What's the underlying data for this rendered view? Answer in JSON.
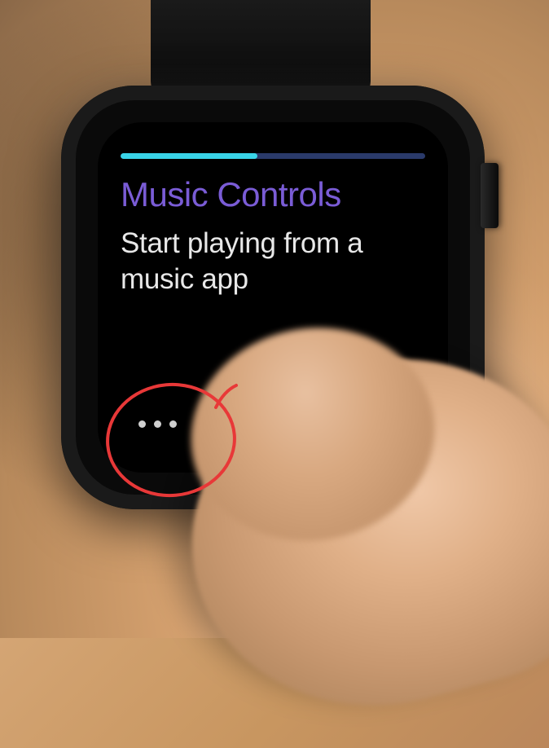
{
  "screen": {
    "title": "Music Controls",
    "subtitle": "Start playing from a music app",
    "progress_percent": 45
  },
  "pagination": {
    "dot_count": 3
  },
  "colors": {
    "title": "#7a5cd6",
    "subtitle": "#e8e8e8",
    "progress_fill": "#39d4e8",
    "progress_track": "#2a3a6a",
    "annotation": "#e83838"
  }
}
